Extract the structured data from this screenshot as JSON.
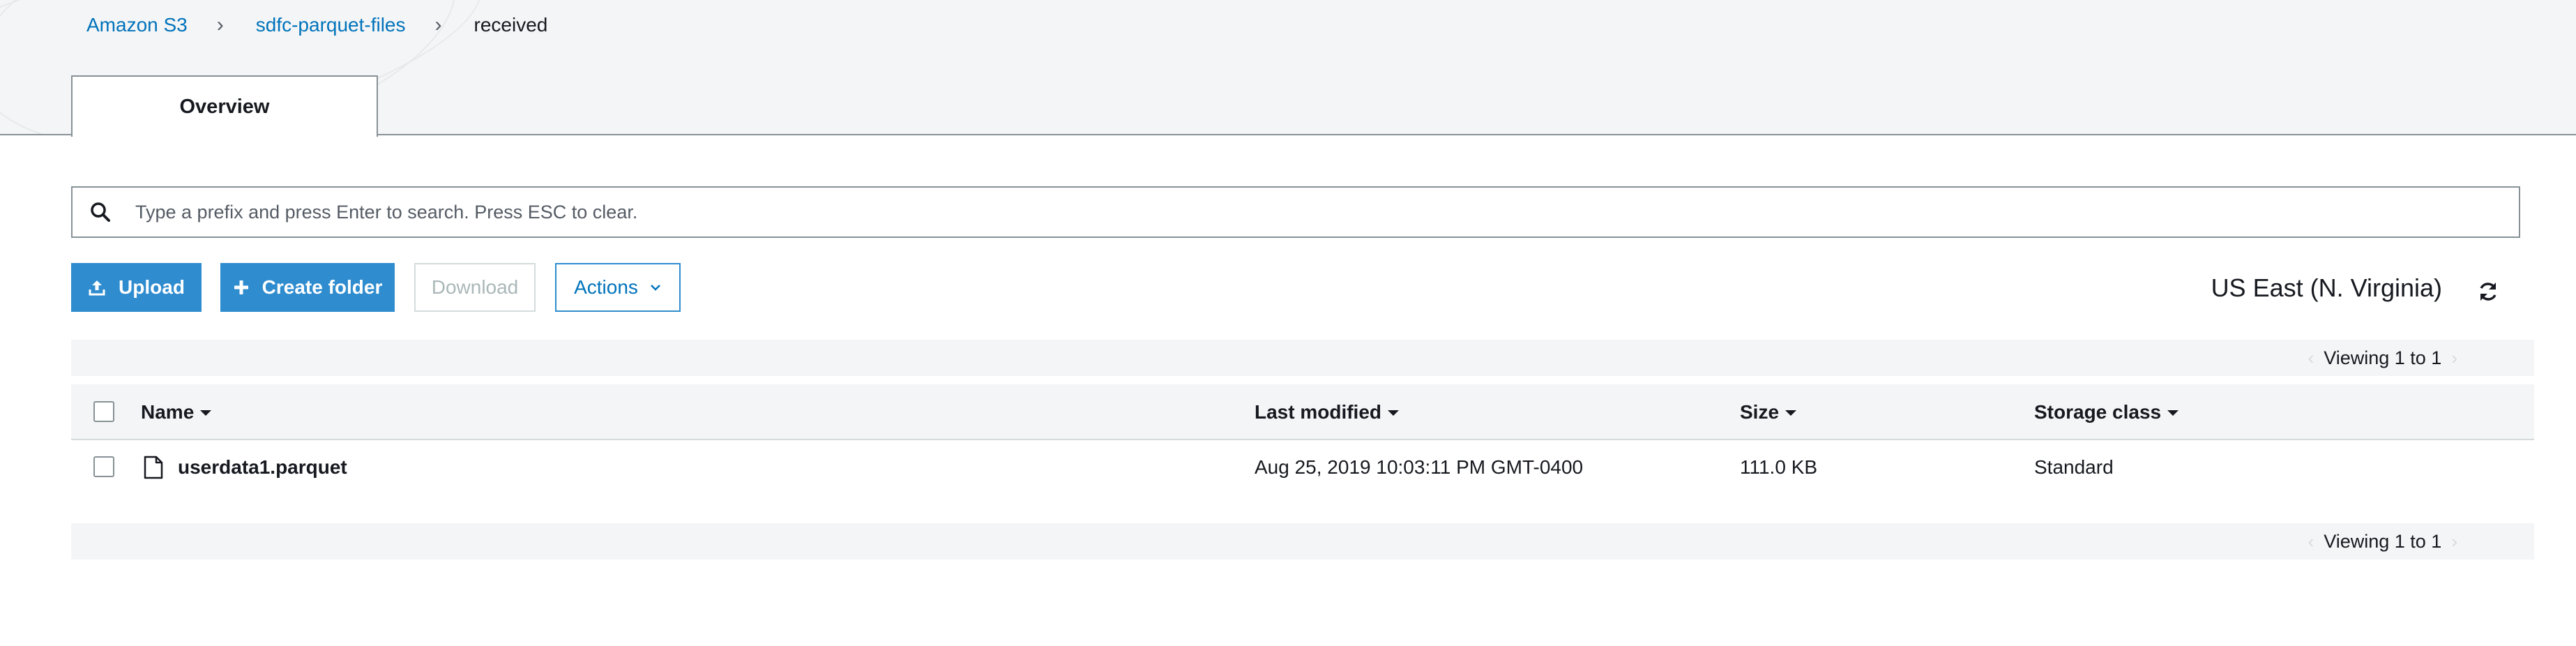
{
  "breadcrumb": {
    "items": [
      "Amazon S3",
      "sdfc-parquet-files"
    ],
    "current": "received"
  },
  "tabs": [
    {
      "label": "Overview",
      "active": true
    }
  ],
  "search": {
    "placeholder": "Type a prefix and press Enter to search. Press ESC to clear.",
    "value": ""
  },
  "toolbar": {
    "upload_label": "Upload",
    "create_folder_label": "Create folder",
    "download_label": "Download",
    "actions_label": "Actions"
  },
  "region": "US East (N. Virginia)",
  "pager": {
    "top_text": "Viewing 1 to 1",
    "bottom_text": "Viewing 1 to 1"
  },
  "table": {
    "columns": [
      "Name",
      "Last modified",
      "Size",
      "Storage class"
    ],
    "rows": [
      {
        "name": "userdata1.parquet",
        "last_modified": "Aug 25, 2019 10:03:11 PM GMT-0400",
        "size": "111.0 KB",
        "storage_class": "Standard"
      }
    ]
  },
  "colors": {
    "accent": "#0073bb",
    "primary_button": "#2e8ccf",
    "disabled_text": "#aab7b8",
    "header_bg": "#f4f5f6"
  },
  "icons": [
    "search-icon",
    "upload-icon",
    "plus-icon",
    "chevron-down-icon",
    "refresh-icon",
    "caret-down-icon",
    "file-icon",
    "chevron-right-icon",
    "chevron-left-icon"
  ]
}
